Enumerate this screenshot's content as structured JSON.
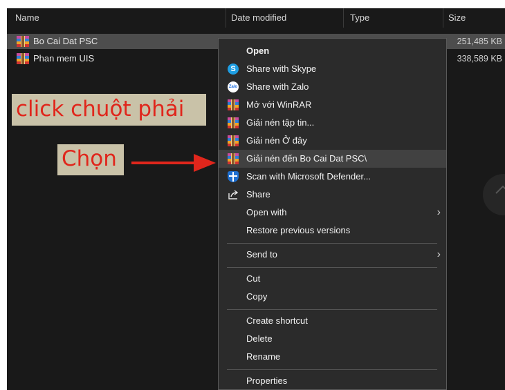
{
  "columns": {
    "name": "Name",
    "date_modified": "Date modified",
    "type": "Type",
    "size": "Size"
  },
  "files": [
    {
      "name": "Bo Cai Dat PSC",
      "size": "251,485 KB",
      "icon": "winrar-archive-icon",
      "selected": true
    },
    {
      "name": "Phan mem UIS",
      "size": "338,589 KB",
      "icon": "winrar-archive-icon",
      "selected": false
    }
  ],
  "annotations": {
    "right_click": "click chuột phải",
    "choose": "Chọn",
    "color": "#e0261c"
  },
  "context_menu": {
    "items": [
      {
        "label": "Open",
        "icon": "",
        "bold": true
      },
      {
        "label": "Share with Skype",
        "icon": "skype-icon"
      },
      {
        "label": "Share with Zalo",
        "icon": "zalo-icon",
        "icon_text": "Zalo"
      },
      {
        "label": "Mở với WinRAR",
        "icon": "winrar-icon"
      },
      {
        "label": "Giải nén tập tin...",
        "icon": "winrar-icon"
      },
      {
        "label": "Giải nén Ở đây",
        "icon": "winrar-icon"
      },
      {
        "label": "Giải nén đến Bo Cai Dat PSC\\",
        "icon": "winrar-icon",
        "highlighted": true
      },
      {
        "label": "Scan with Microsoft Defender...",
        "icon": "defender-icon"
      },
      {
        "label": "Share",
        "icon": "share-icon"
      },
      {
        "label": "Open with",
        "icon": "",
        "submenu": true
      },
      {
        "label": "Restore previous versions",
        "icon": ""
      },
      {
        "label": "Send to",
        "icon": "",
        "submenu": true
      },
      {
        "label": "Cut",
        "icon": ""
      },
      {
        "label": "Copy",
        "icon": ""
      },
      {
        "label": "Create shortcut",
        "icon": ""
      },
      {
        "label": "Delete",
        "icon": ""
      },
      {
        "label": "Rename",
        "icon": ""
      },
      {
        "label": "Properties",
        "icon": ""
      }
    ]
  },
  "colors": {
    "background": "#191919",
    "menu_bg": "#2b2b2b",
    "highlight": "#414141",
    "annotation_bg": "#c9c2a8"
  }
}
